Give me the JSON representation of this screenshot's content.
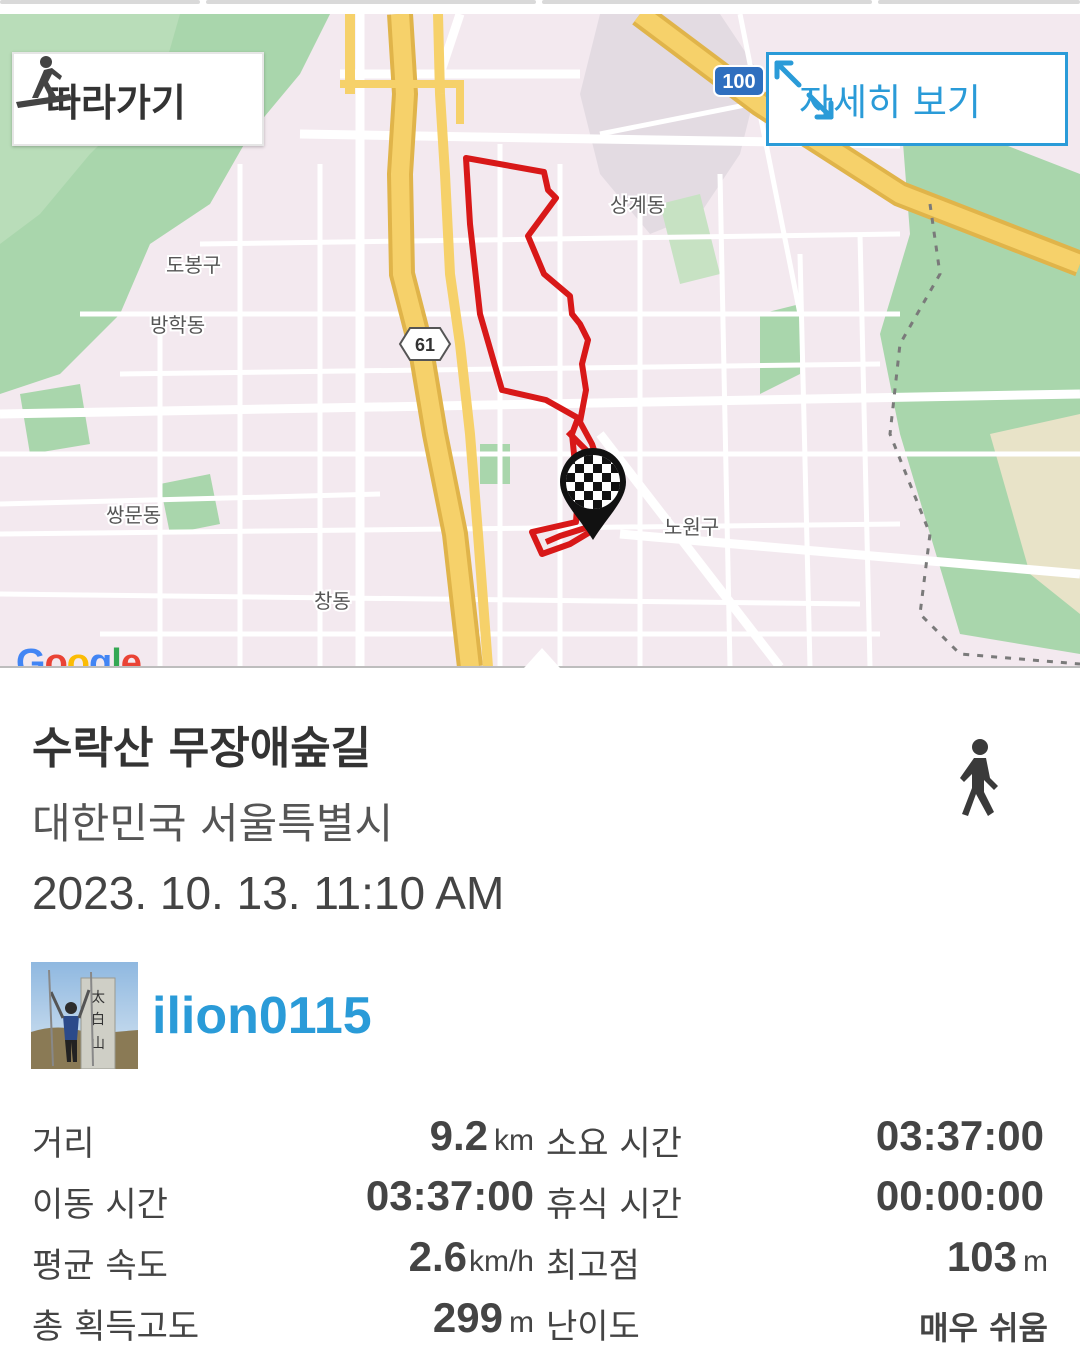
{
  "map": {
    "follow_label": "따라가기",
    "detail_label": "자세히 보기",
    "google_logo": "Google",
    "road_badges": [
      "100",
      "61"
    ],
    "place_labels": [
      "상계동",
      "도봉구",
      "방학동",
      "쌍문동",
      "노원구",
      "창동"
    ],
    "route_color": "#d81818",
    "accent_color": "#2a9bd8",
    "icons": [
      "hiker-icon",
      "expand-arrows-icon",
      "finish-flag-pin-icon"
    ]
  },
  "course": {
    "title": "수락산 무장애숲길",
    "location": "대한민국 서울특별시",
    "datetime": "2023. 10. 13. 11:10 AM",
    "activity_icon": "walking-person-icon"
  },
  "user": {
    "name": "ilion0115",
    "avatar_icon": "profile-photo"
  },
  "stats": {
    "distance": {
      "label": "거리",
      "value": "9.2",
      "unit": "km"
    },
    "total_time": {
      "label": "소요 시간",
      "value": "03:37:00"
    },
    "moving_time": {
      "label": "이동 시간",
      "value": "03:37:00"
    },
    "rest_time": {
      "label": "휴식 시간",
      "value": "00:00:00"
    },
    "avg_speed": {
      "label": "평균 속도",
      "value": "2.6",
      "unit": "km/h"
    },
    "max_altitude": {
      "label": "최고점",
      "value": "103",
      "unit": "m"
    },
    "elevation_gain": {
      "label": "총 획득고도",
      "value": "299",
      "unit": "m"
    },
    "difficulty": {
      "label": "난이도",
      "value": "매우 쉬움"
    }
  }
}
